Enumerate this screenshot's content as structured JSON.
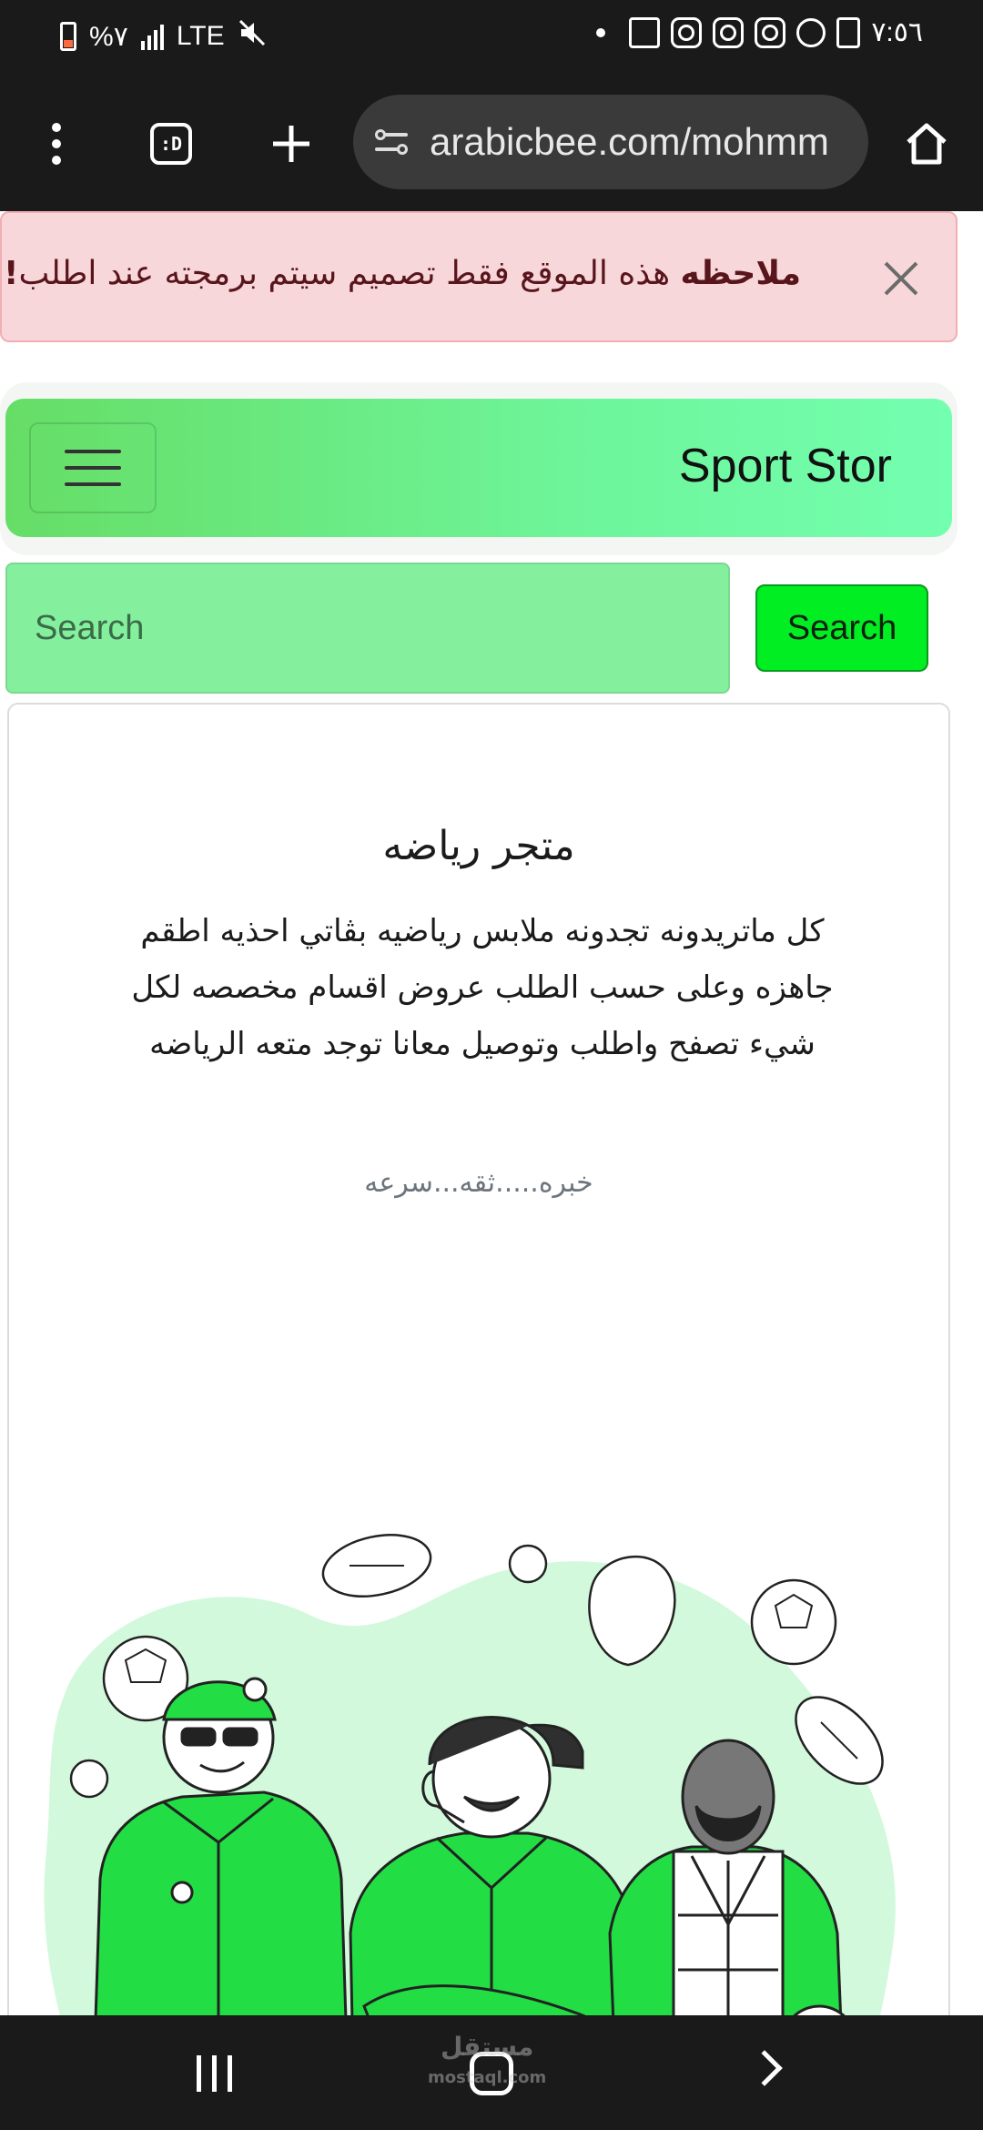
{
  "status_bar": {
    "battery_text": "%٧",
    "network": "LTE",
    "time": "٧:٥٦"
  },
  "browser": {
    "tabs_icon_text": ":D",
    "url": "arabicbee.com/mohmm"
  },
  "alert": {
    "bold_label": "ملاحظه",
    "message": " هذه الموقع فقط تصميم سيتم برمجته عند اطلب",
    "emphasis": "!"
  },
  "navbar": {
    "brand": "Sport Stor"
  },
  "search": {
    "placeholder": "Search",
    "button_label": "Search"
  },
  "card": {
    "title": "متجر رياضه",
    "description": "كل ماتريدونه تجدونه ملابس رياضيه بڤاتي احذيه اطقم جاهزه وعلى حسب الطلب عروض اقسام مخصصه لكل شيء تصفح واطلب وتوصيل معانا توجد متعه الرياضه",
    "tagline": "خبره.....ثقه...سرعه"
  },
  "watermark": {
    "arabic": "مستقل",
    "latin": "mostaql.com"
  },
  "colors": {
    "navbar_gradient_start": "#66dd66",
    "navbar_gradient_end": "#73ffb0",
    "search_input_bg": "#84f09e",
    "search_button_bg": "#00ee22",
    "alert_bg": "#f8d7da",
    "illustration_green": "#22dd44"
  }
}
